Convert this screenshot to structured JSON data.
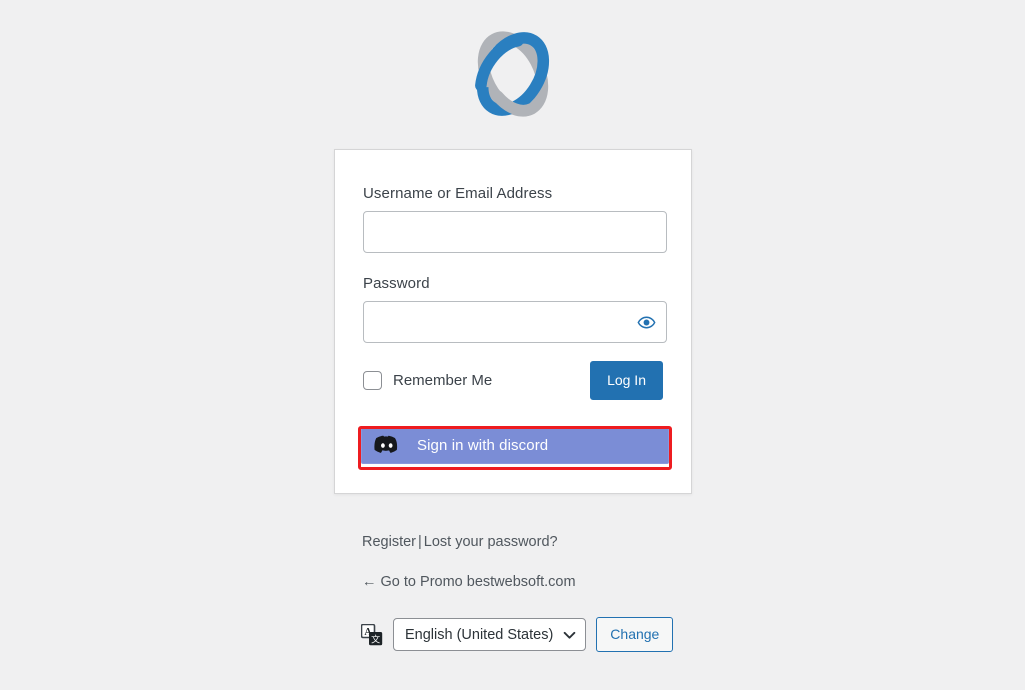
{
  "page": {
    "background_color": "#f0f0f1",
    "logo_alt": "bestwebsoft-logo"
  },
  "login_form": {
    "username": {
      "label": "Username or Email Address",
      "value": "",
      "placeholder": ""
    },
    "password": {
      "label": "Password",
      "value": "",
      "placeholder": "",
      "show_password_icon": "eye-icon"
    },
    "remember_me": {
      "label": "Remember Me",
      "checked": false
    },
    "submit": {
      "label": "Log In",
      "color": "#2271b1"
    },
    "social_login": {
      "label": "Sign in with discord",
      "icon": "discord-icon",
      "background_color": "#7b8dd6",
      "highlight_color": "#ee1c20",
      "highlighted": true
    }
  },
  "footer_links": {
    "register": "Register",
    "separator": "|",
    "lost_password": "Lost your password?",
    "back_to_site": "← Go to Promo bestwebsoft.com"
  },
  "language_switcher": {
    "icon": "translate-icon",
    "selected": "English (United States)",
    "options": [
      "English (United States)"
    ],
    "change_button": "Change",
    "change_button_color": "#2271b1"
  }
}
